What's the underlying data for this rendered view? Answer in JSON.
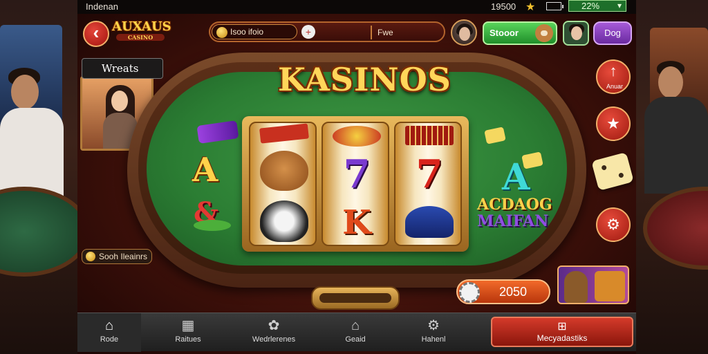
{
  "status": {
    "carrier": "Indenan",
    "time": "19500",
    "badge": "22%"
  },
  "header": {
    "brand": "AUXAUS",
    "brand_tag": "CASINO",
    "coin_balance": "Isoo ifoio",
    "side_label": "Fwe",
    "green_button": "Stooor",
    "purple_button": "Dog"
  },
  "promo": {
    "label": "Wreats"
  },
  "game": {
    "title": "KASINOS",
    "combo_line1": "ACDAOG",
    "combo_line2": "MAIFAN"
  },
  "reels": [
    {
      "top": "bar",
      "mid": "dog-face",
      "bottom": "husky"
    },
    {
      "top": "cherry",
      "mid": "7",
      "bottom": "K"
    },
    {
      "top": "bar",
      "mid": "7",
      "bottom": "hat"
    }
  ],
  "side_buttons": [
    {
      "label": "Anuar"
    }
  ],
  "hint": {
    "label": "Sooh Ileainrs"
  },
  "bet": {
    "value": "2050"
  },
  "nav": {
    "items": [
      {
        "label": "Rode",
        "icon": "home-icon"
      },
      {
        "label": "Raitues",
        "icon": "calendar-icon"
      },
      {
        "label": "Wedrlerenes",
        "icon": "flower-icon"
      },
      {
        "label": "Geaid",
        "icon": "house-outline-icon"
      },
      {
        "label": "Hahenl",
        "icon": "gear-icon"
      }
    ],
    "cta": "Mecyadastiks"
  },
  "colors": {
    "felt": "#2b7d33",
    "accent_red": "#c42a1c",
    "gold": "#ffd65a",
    "green_button": "#2fae39",
    "purple_button": "#8a3fc4"
  }
}
